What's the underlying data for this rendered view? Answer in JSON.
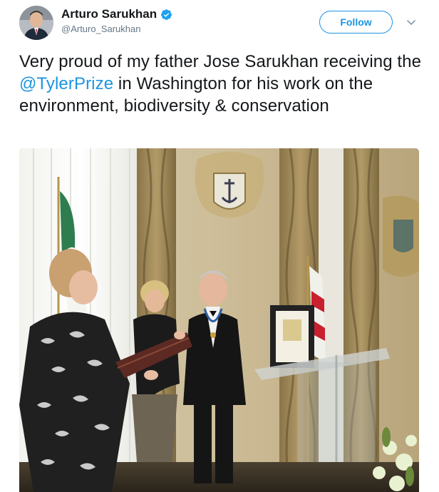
{
  "author": {
    "display_name": "Arturo Sarukhan",
    "handle": "@Arturo_Sarukhan",
    "verified": true,
    "avatar_icon": "profile-photo"
  },
  "follow_button": {
    "label": "Follow"
  },
  "menu_icon": "chevron-down-icon",
  "tweet": {
    "text_before": "Very proud of my father Jose Sarukhan receiving the ",
    "mention": "@TylerPrize",
    "text_after": " in Washington for his work on the environment, biodiversity & conservation"
  },
  "media": {
    "type": "photo"
  },
  "colors": {
    "accent": "#1b95e0",
    "text": "#14171a",
    "secondary": "#657786"
  }
}
